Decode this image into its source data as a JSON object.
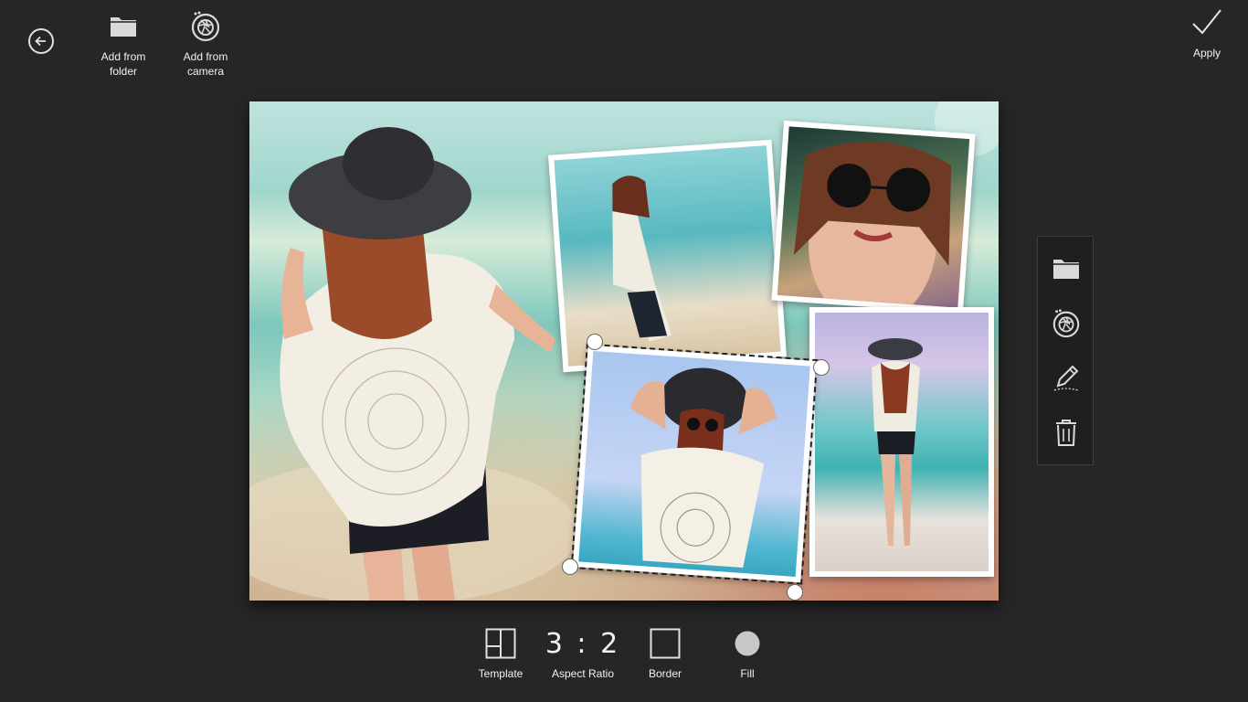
{
  "toolbar": {
    "back_icon": "back-arrow-icon",
    "add_folder": {
      "label": "Add from\nfolder",
      "icon": "folder-icon"
    },
    "add_camera": {
      "label": "Add from\ncamera",
      "icon": "camera-aperture-icon"
    },
    "apply": {
      "label": "Apply",
      "icon": "checkmark-icon"
    }
  },
  "side_panel": {
    "items": [
      {
        "icon": "folder-icon"
      },
      {
        "icon": "camera-aperture-icon"
      },
      {
        "icon": "pencil-edit-icon"
      },
      {
        "icon": "trash-icon"
      }
    ]
  },
  "bottom": {
    "template": {
      "label": "Template",
      "icon": "template-layout-icon"
    },
    "aspect_ratio": {
      "label": "Aspect Ratio",
      "value": "3 : 2"
    },
    "border": {
      "label": "Border",
      "icon": "border-square-icon"
    },
    "fill": {
      "label": "Fill",
      "icon": "fill-circle-icon"
    }
  },
  "colors": {
    "background": "#262626",
    "panel": "#1f1f1f",
    "text": "#f2f2f2",
    "fill_swatch": "#c8c8c8"
  }
}
